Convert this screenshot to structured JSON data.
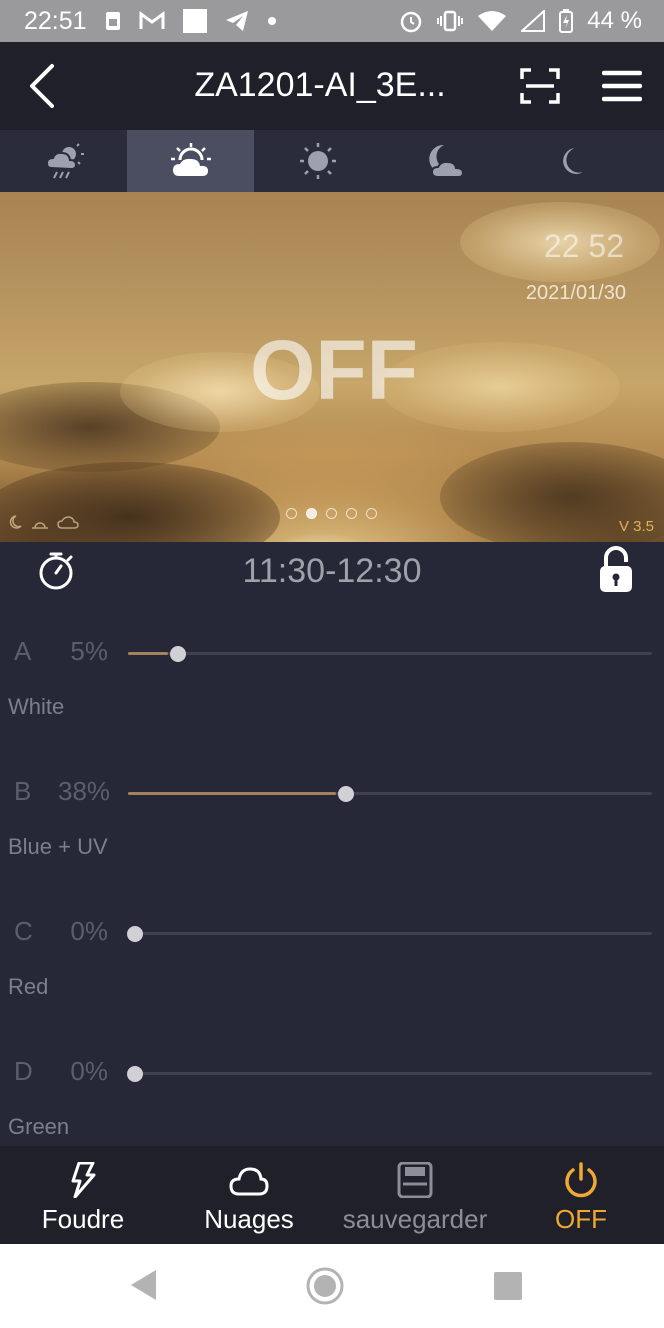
{
  "status_bar": {
    "time": "22:51",
    "battery": "44 %",
    "left_icons": [
      "sim-card-icon",
      "gmail-icon",
      "gallery-icon",
      "telegram-icon",
      "dot-icon"
    ],
    "right_icons": [
      "alarm-icon",
      "vibrate-icon",
      "wifi-icon",
      "signal-icon",
      "battery-icon"
    ]
  },
  "header": {
    "title": "ZA1201-AI_3E...",
    "icons": [
      "back-arrow-icon",
      "scan-icon",
      "menu-icon"
    ]
  },
  "mode_tabs": [
    {
      "name": "stormy-weather",
      "icon": "storm-cloud-icon"
    },
    {
      "name": "sunrise",
      "icon": "sunrise-icon",
      "active": true
    },
    {
      "name": "sunny",
      "icon": "sun-icon"
    },
    {
      "name": "night-cloudy",
      "icon": "moon-cloud-icon"
    },
    {
      "name": "night",
      "icon": "moon-icon"
    }
  ],
  "preview": {
    "time": "22 52",
    "date": "2021/01/30",
    "state": "OFF",
    "version": "V 3.5",
    "page_count": 5,
    "active_page": 2
  },
  "schedule": {
    "time_range": "11:30-12:30"
  },
  "channels": [
    {
      "letter": "A",
      "percent_text": "5%",
      "value": 5,
      "name": "White"
    },
    {
      "letter": "B",
      "percent_text": "38%",
      "value": 38,
      "name": "Blue + UV"
    },
    {
      "letter": "C",
      "percent_text": "0%",
      "value": 0,
      "name": "Red"
    },
    {
      "letter": "D",
      "percent_text": "0%",
      "value": 0,
      "name": "Green"
    }
  ],
  "bottom_bar": {
    "lightning": "Foudre",
    "clouds": "Nuages",
    "save": "sauvegarder",
    "power": "OFF"
  },
  "colors": {
    "accent": "#f0a830",
    "slider_fill": "#a6825a",
    "background": "#262837"
  }
}
